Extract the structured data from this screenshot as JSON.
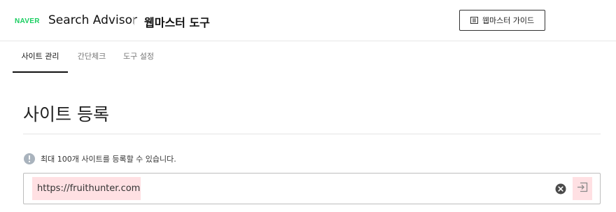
{
  "header": {
    "logo_text": "NAVER",
    "product_name": "Search Advisor",
    "tool_title": "웹마스터 도구",
    "guide_button": {
      "label": "웹마스터 가이드",
      "icon": "document-list-icon"
    }
  },
  "tabs": [
    {
      "label": "사이트 관리",
      "active": true
    },
    {
      "label": "간단체크",
      "active": false
    },
    {
      "label": "도구 설정",
      "active": false
    }
  ],
  "main": {
    "title": "사이트 등록",
    "notice": {
      "icon": "info-icon",
      "text": "최대 100개 사이트를 등록할 수 있습니다."
    },
    "site_input": {
      "value": "https://fruithunter.com",
      "clear_icon": "clear-icon",
      "submit_icon": "submit-arrow-icon"
    }
  },
  "colors": {
    "brand_green": "#19ce60",
    "highlight": "#ffe0e3",
    "text": "#222222"
  }
}
